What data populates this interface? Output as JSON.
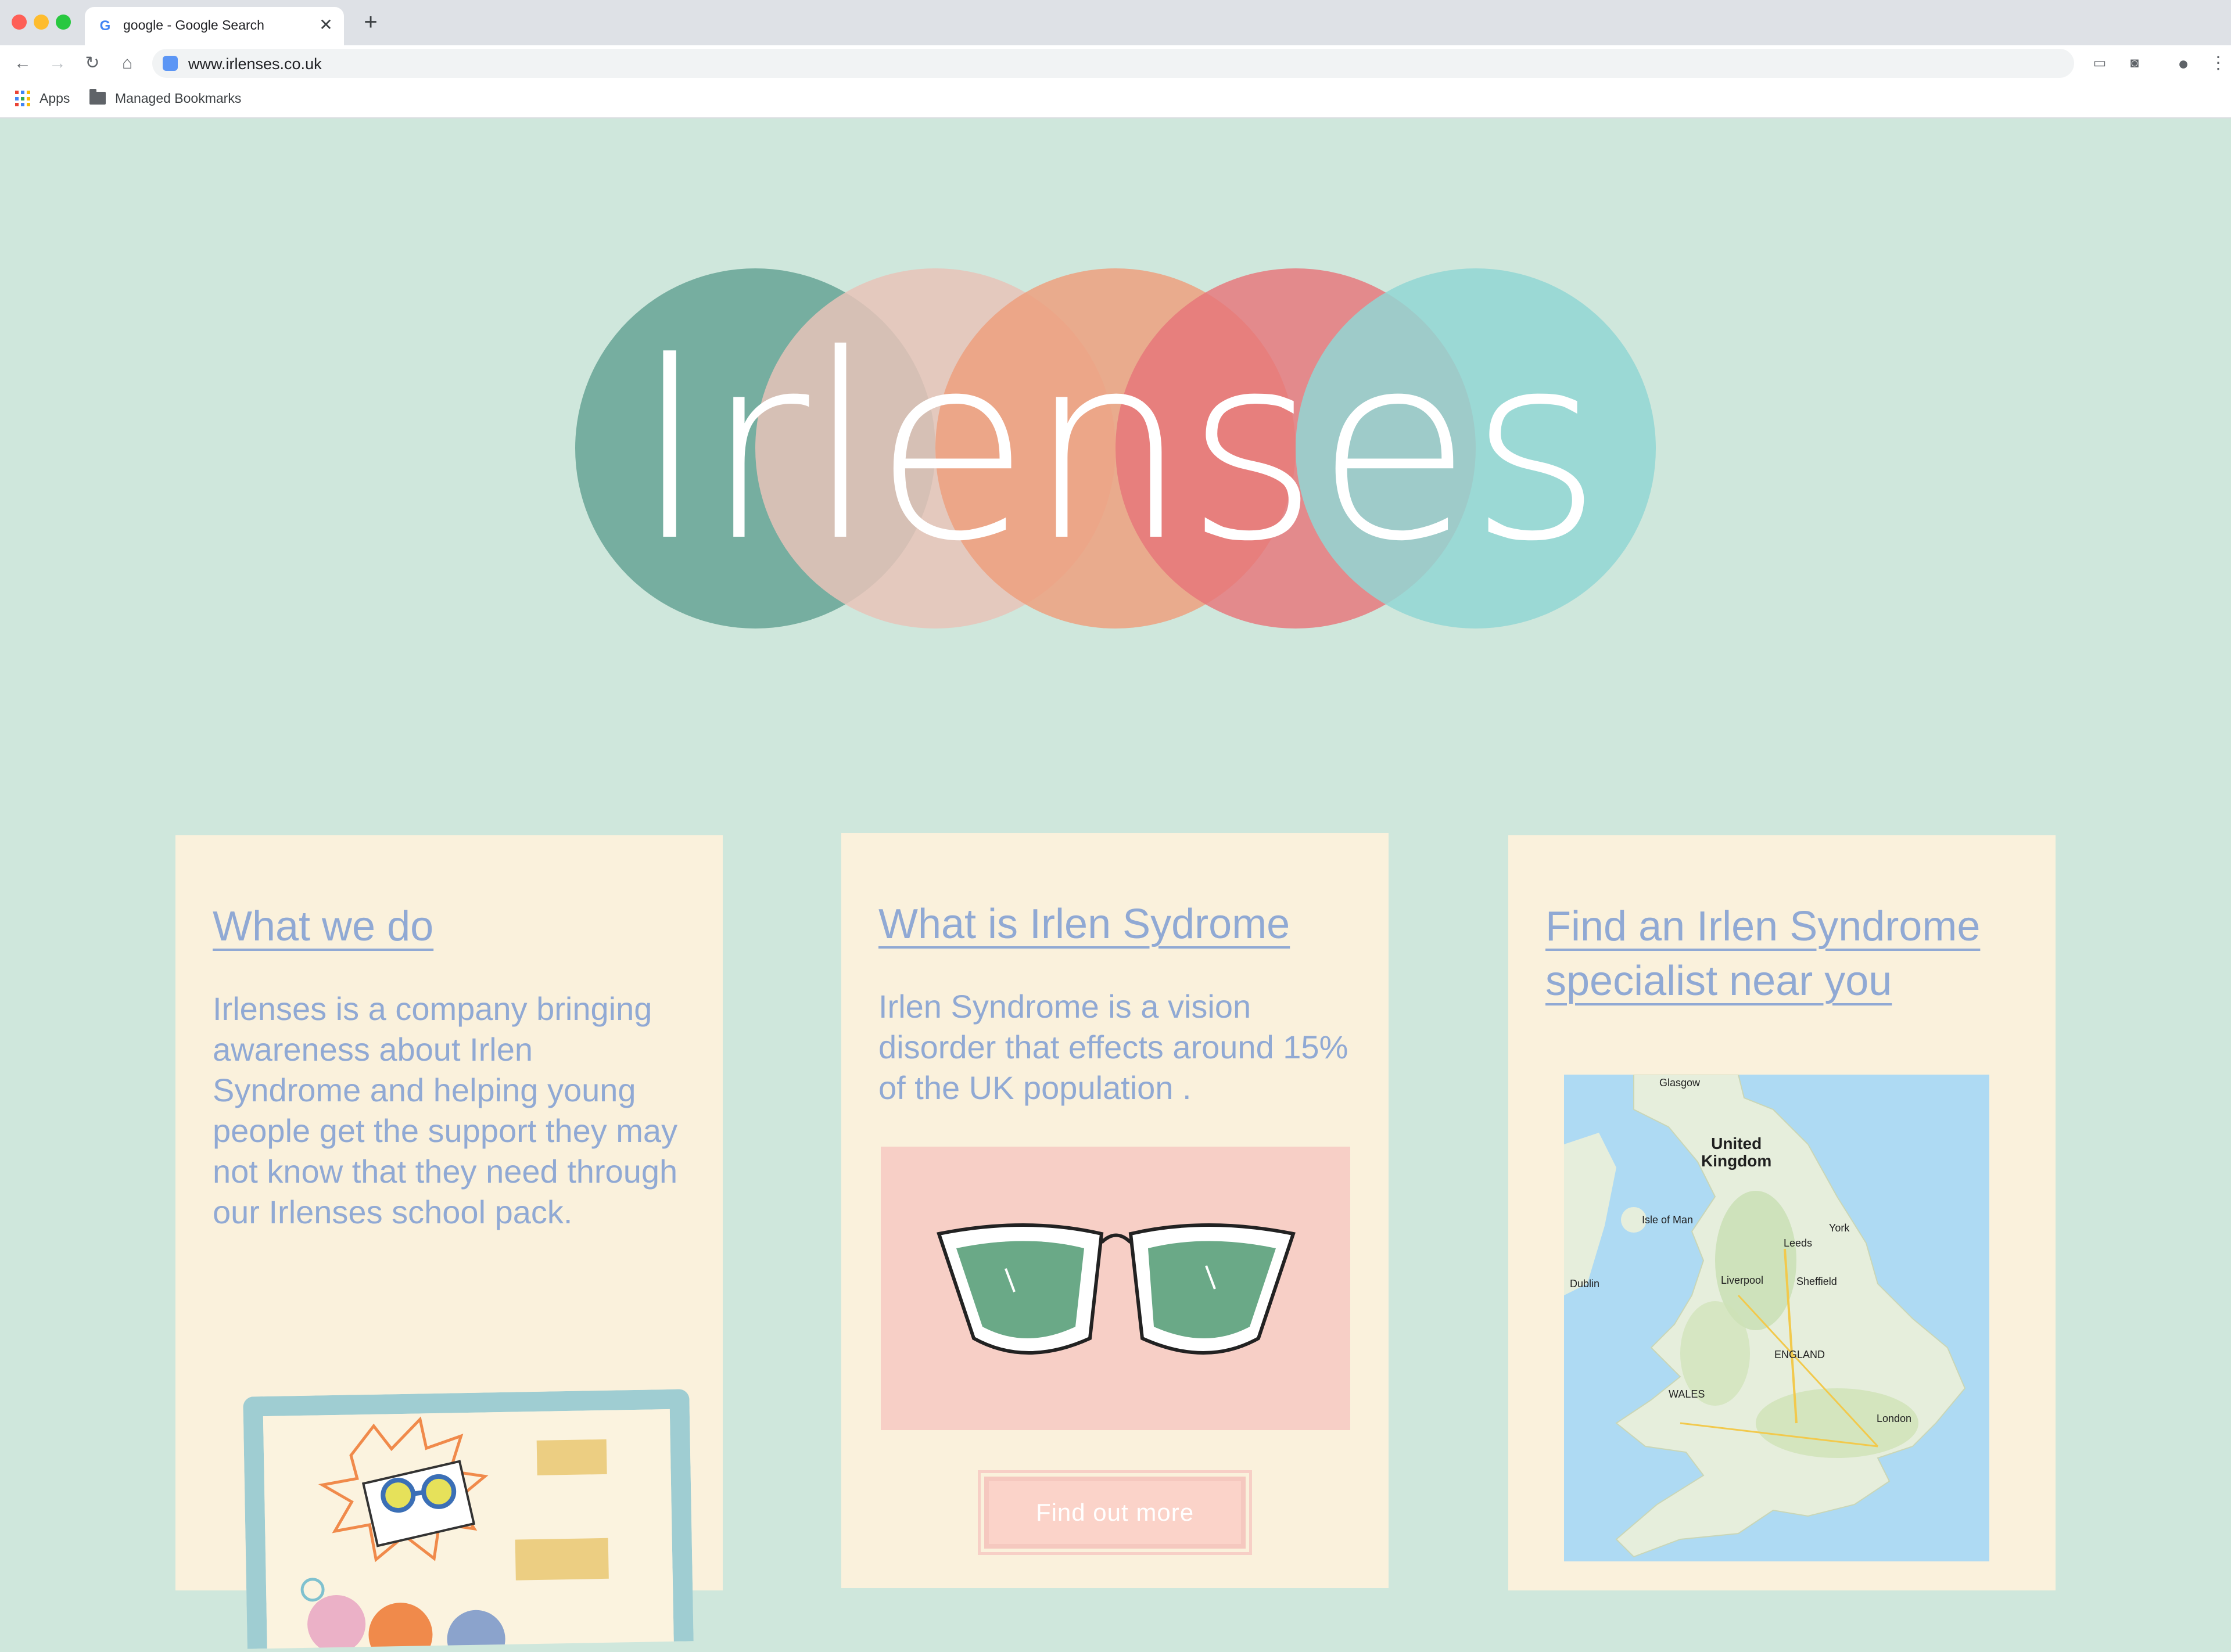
{
  "browser": {
    "tab_title": "google - Google Search",
    "tab_favicon": "G",
    "tab_close": "✕",
    "new_tab": "+",
    "url": "www.irlenses.co.uk",
    "bookmarks": [
      {
        "label": "Apps",
        "icon": "apps-grid-icon"
      },
      {
        "label": "Managed Bookmarks",
        "icon": "folder-icon"
      }
    ],
    "nav_icons": {
      "back": "←",
      "forward": "→",
      "reload": "↻",
      "home": "⌂",
      "menu": "⋮"
    }
  },
  "logo": {
    "text": "Irlenses",
    "circle_colors": [
      "#6fa99a",
      "#e8c3b8",
      "#eda07f",
      "#e7757a",
      "#92d6d4"
    ]
  },
  "cards": [
    {
      "title": "What we do",
      "body": "Irlenses is a company bringing awareness about Irlen Syndrome and helping young people get the support they may not know that they need through our Irlenses school pack."
    },
    {
      "title": "What is Irlen Sydrome",
      "body": "Irlen Syndrome is a vision disorder that effects around 15% of the UK population .",
      "button": "Find out more"
    },
    {
      "title": "Find an Irlen Syndrome specialist near you",
      "map_labels": {
        "country": "United\nKingdom",
        "glasgow": "Glasgow",
        "isle_of_man": "Isle of Man",
        "dublin": "Dublin",
        "leeds": "Leeds",
        "sheffield": "Sheffield",
        "england": "ENGLAND",
        "wales": "WALES",
        "london": "London",
        "liverpool": "Liverpool",
        "york": "York"
      }
    }
  ],
  "colors": {
    "page_bg": "#cfe7dc",
    "card_bg": "#faf1dc",
    "link_text": "#90a9d4",
    "panel_pink": "#f7cfc6",
    "lens_green": "#6aa987"
  }
}
